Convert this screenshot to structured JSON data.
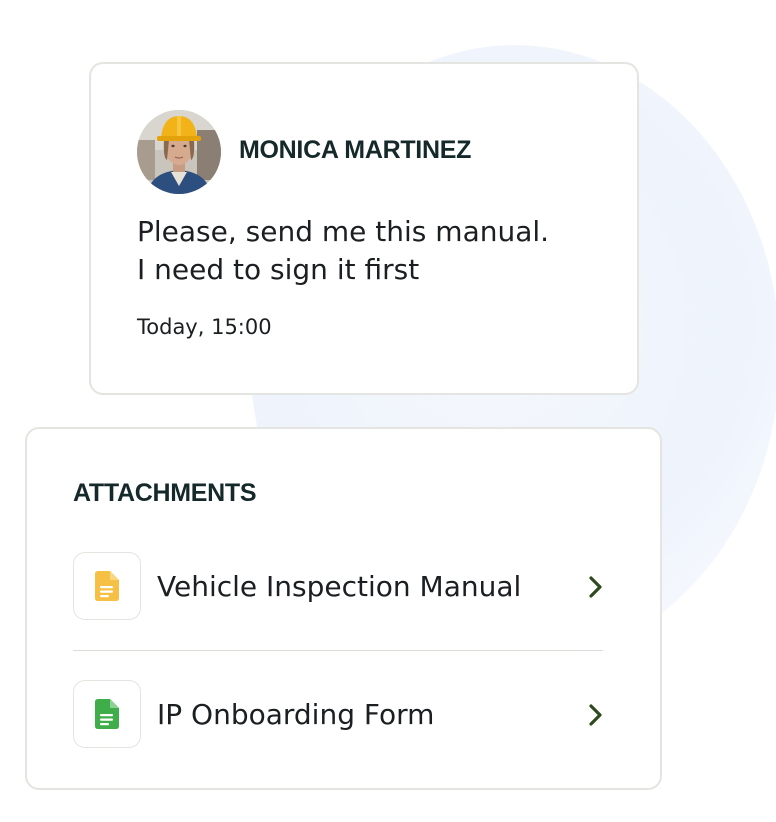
{
  "message": {
    "author": "MONICA MARTINEZ",
    "text_line1": "Please, send me this manual.",
    "text_line2": "I need to sign it first",
    "time": "Today, 15:00"
  },
  "attachments": {
    "title": "ATTACHMENTS",
    "items": [
      {
        "label": "Vehicle Inspection Manual",
        "icon": "document-icon",
        "icon_color": "#f5c043"
      },
      {
        "label": "IP Onboarding Form",
        "icon": "document-icon",
        "icon_color": "#3fae4a"
      }
    ]
  },
  "colors": {
    "chevron": "#2f4a1e",
    "heading": "#15282a"
  }
}
